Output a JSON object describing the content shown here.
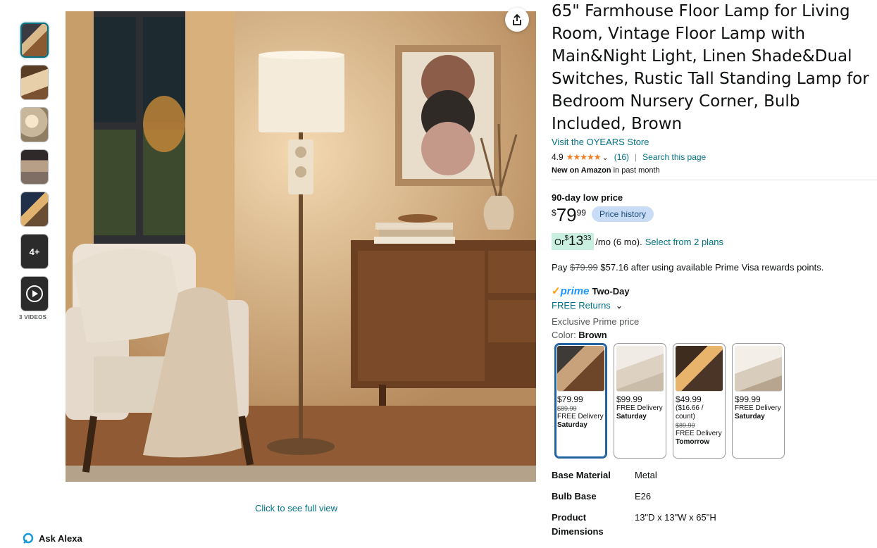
{
  "gallery": {
    "videos_label": "3 VIDEOS",
    "more_label": "4+",
    "full_view_link": "Click to see full view",
    "ask_alexa": "Ask Alexa"
  },
  "product": {
    "title": "65\" Farmhouse Floor Lamp for Living Room, Vintage Floor Lamp with Main&Night Light, Linen Shade&Dual Switches, Rustic Tall Standing Lamp for Bedroom Nursery Corner, Bulb Included, Brown",
    "store_link": "Visit the OYEARS Store",
    "rating": "4.9",
    "stars": "★★★★★",
    "review_count": "(16)",
    "search_page": "Search this page",
    "new_label": "New on Amazon",
    "new_suffix": " in past month"
  },
  "pricing": {
    "low_label": "90-day low price",
    "currency": "$",
    "whole": "79",
    "fraction": "99",
    "history_button": "Price history",
    "monthly_prefix": "Or ",
    "monthly_whole": "13",
    "monthly_fraction": "33",
    "monthly_suffix": "/mo (6 mo).",
    "plans_link": "Select from 2 plans",
    "pay_prefix": "Pay ",
    "pay_old": "$79.99",
    "pay_text": " $57.16 after using available Prime Visa rewards points."
  },
  "delivery": {
    "prime_check": "✓",
    "prime_word": "prime",
    "two_day": "Two-Day",
    "free_returns": "FREE Returns",
    "exclusive": "Exclusive Prime price",
    "color_label": "Color: ",
    "color_value": "Brown"
  },
  "swatches": [
    {
      "price": "$79.99",
      "old": "$89.99",
      "per": "",
      "delivery": "FREE Delivery",
      "day": "Saturday"
    },
    {
      "price": "$99.99",
      "old": "",
      "per": "",
      "delivery": "FREE Delivery",
      "day": "Saturday"
    },
    {
      "price": "$49.99",
      "old": "$89.99",
      "per": "($16.66 / count)",
      "delivery": "FREE Delivery",
      "day": "Tomorrow"
    },
    {
      "price": "$99.99",
      "old": "",
      "per": "",
      "delivery": "FREE Delivery",
      "day": "Saturday"
    }
  ],
  "specs": [
    {
      "key": "Base Material",
      "value": "Metal"
    },
    {
      "key": "Bulb Base",
      "value": "E26"
    },
    {
      "key": "Product Dimensions",
      "value": "13\"D x 13\"W x 65\"H"
    }
  ]
}
